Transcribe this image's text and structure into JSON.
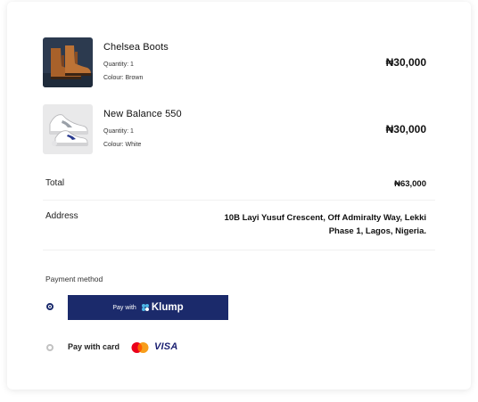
{
  "order": {
    "items": [
      {
        "name": "Chelsea Boots",
        "quantity": "Quantity: 1",
        "colour": "Colour: Brown",
        "price": "₦30,000",
        "icon": "chelsea-boots-image"
      },
      {
        "name": "New Balance 550",
        "quantity": "Quantity: 1",
        "colour": "Colour: White",
        "price": "₦30,000",
        "icon": "sneakers-image"
      }
    ],
    "total": {
      "label": "Total",
      "value": "₦63,000"
    },
    "address": {
      "label": "Address",
      "value": "10B Layi Yusuf Crescent, Off Admiralty Way,  Lekki Phase 1, Lagos, Nigeria."
    }
  },
  "payment": {
    "label": "Payment method",
    "options": [
      {
        "prefix": "Pay with",
        "brand": "Klump",
        "selected": true
      },
      {
        "label": "Pay with card",
        "selected": false,
        "logos": [
          "mastercard-logo",
          "visa-logo"
        ],
        "visa_text": "VISA"
      }
    ]
  },
  "colors": {
    "klump_button": "#1b2a6b",
    "klump_mark": "#4fb8e8",
    "radio_selected": "#1a2a6c",
    "radio_unselected": "#c2c2c2",
    "visa_blue": "#1a1f71",
    "mastercard_red": "#eb001b",
    "mastercard_yellow": "#f79e1b"
  }
}
